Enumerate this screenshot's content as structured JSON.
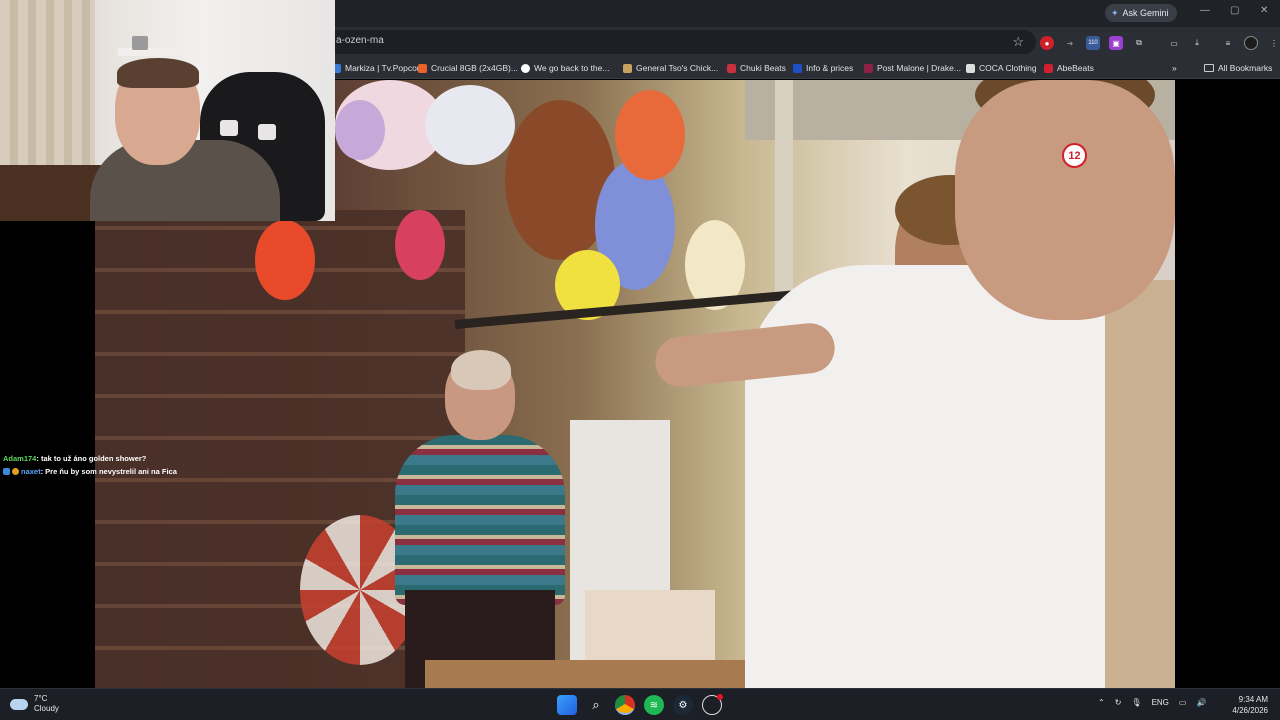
{
  "browser": {
    "url": "a-ozen-ma",
    "ask_gemini": "Ask Gemini",
    "extension_badge": "110",
    "bookmarks": [
      {
        "label": "Markiza | Tv.Popcor...",
        "color": "#3a7bd5"
      },
      {
        "label": "Crucial 8GB (2x4GB)...",
        "color": "#e8622a"
      },
      {
        "label": "We go back to the...",
        "color": "#ffffff"
      },
      {
        "label": "General Tso's Chick...",
        "color": "#c8a060"
      },
      {
        "label": "Chuki Beats",
        "color": "#c83040"
      },
      {
        "label": "Info & prices",
        "color": "#2050c8"
      },
      {
        "label": "Post Malone | Drake...",
        "color": "#902048"
      },
      {
        "label": "COCA Clothing",
        "color": "#dddddd"
      },
      {
        "label": "AbeBeats",
        "color": "#d02030"
      }
    ],
    "all_bookmarks": "All Bookmarks"
  },
  "video": {
    "channel_badge": "12"
  },
  "chat": {
    "messages": [
      {
        "user": "Adam174",
        "text": ": tak to už áno golden shower?"
      },
      {
        "user": "naxet",
        "text": ": Pre ňu by som nevystrelil ani na Fica"
      }
    ]
  },
  "taskbar": {
    "weather_temp": "7°C",
    "weather_desc": "Cloudy",
    "language": "ENG",
    "time": "9:34 AM",
    "date": "4/26/2026"
  }
}
